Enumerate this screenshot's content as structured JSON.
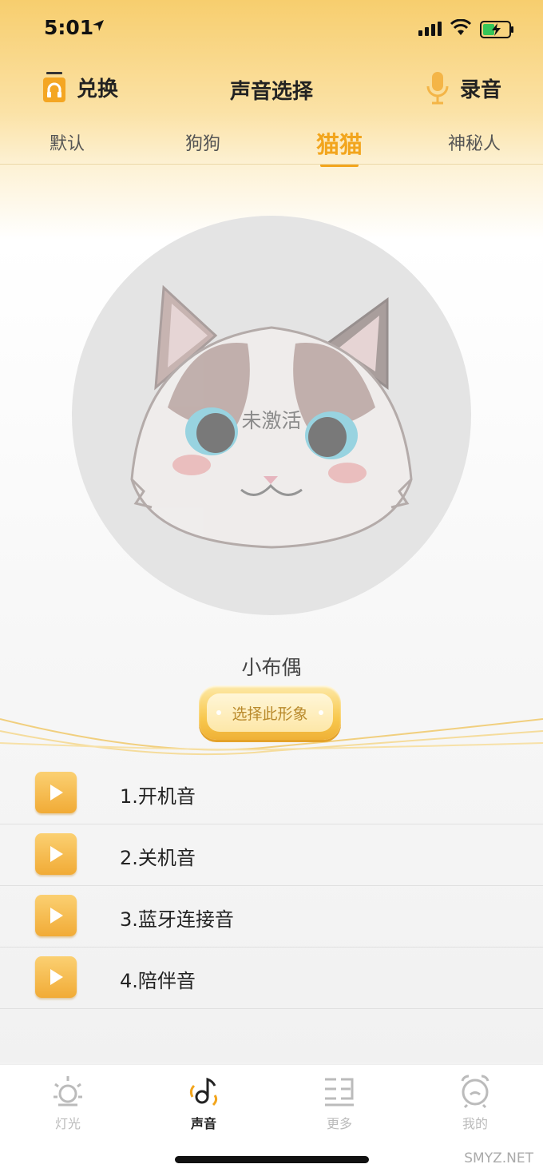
{
  "status_bar": {
    "time": "5:01"
  },
  "header": {
    "exchange_label": "兑换",
    "title": "声音选择",
    "record_label": "录音"
  },
  "tabs": [
    {
      "label": "默认"
    },
    {
      "label": "狗狗"
    },
    {
      "label": "猫猫",
      "active": true
    },
    {
      "label": "神秘人"
    }
  ],
  "character": {
    "status_overlay": "未激活",
    "name": "小布偶",
    "select_button": "选择此形象"
  },
  "sounds": [
    {
      "label": "1.开机音"
    },
    {
      "label": "2.关机音"
    },
    {
      "label": "3.蓝牙连接音"
    },
    {
      "label": "4.陪伴音"
    }
  ],
  "tabbar": [
    {
      "label": "灯光",
      "icon": "light-icon"
    },
    {
      "label": "声音",
      "icon": "sound-icon",
      "active": true
    },
    {
      "label": "更多",
      "icon": "more-icon"
    },
    {
      "label": "我的",
      "icon": "alarm-clock-icon"
    }
  ],
  "watermark": "SMYZ.NET",
  "colors": {
    "accent": "#f2a51d",
    "play_button": "#f4b547"
  }
}
